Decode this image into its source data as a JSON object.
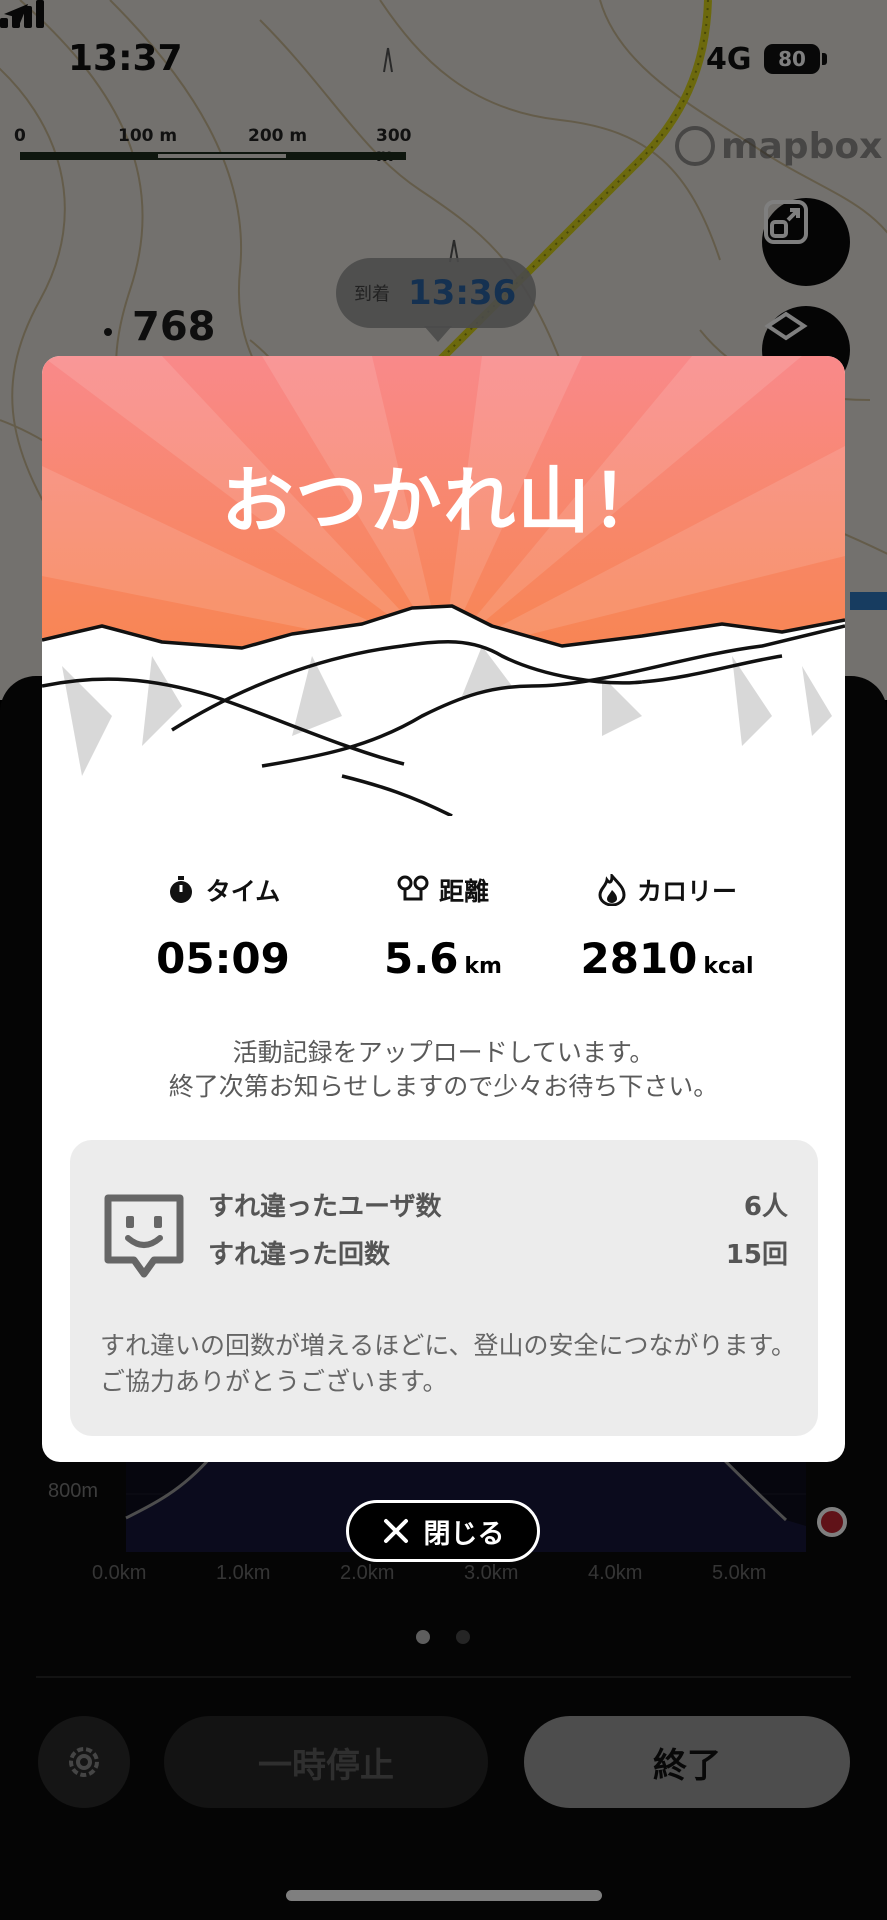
{
  "status_bar": {
    "time": "13:37",
    "network": "4G",
    "battery": "80"
  },
  "map": {
    "scale": {
      "ticks": [
        "0",
        "100 m",
        "200 m",
        "300 m"
      ]
    },
    "attribution": "mapbox",
    "arrival": {
      "label": "到着",
      "time": "13:36"
    },
    "elevation_label": "768"
  },
  "modal": {
    "title": "おつかれ山！",
    "stats": [
      {
        "label": "タイム",
        "value": "05:09",
        "unit": "",
        "icon": "stopwatch-icon"
      },
      {
        "label": "距離",
        "value": "5.6",
        "unit": "km",
        "icon": "route-icon"
      },
      {
        "label": "カロリー",
        "value": "2810",
        "unit": "kcal",
        "icon": "flame-icon"
      }
    ],
    "upload_message": {
      "line1": "活動記録をアップロードしています。",
      "line2": "終了次第お知らせしますので少々お待ち下さい。"
    },
    "passing": {
      "users_label": "すれ違ったユーザ数",
      "users_value": "6人",
      "count_label": "すれ違った回数",
      "count_value": "15回",
      "note": "すれ違いの回数が増えるほどに、登山の安全につながります。ご協力ありがとうございます。"
    }
  },
  "close_button": {
    "label": "閉じる"
  },
  "profile_chart": {
    "y_label": "800m",
    "x_ticks": [
      "0.0km",
      "1.0km",
      "2.0km",
      "3.0km",
      "4.0km",
      "5.0km"
    ]
  },
  "controls": {
    "pause_label": "一時停止",
    "end_label": "終了"
  },
  "colors": {
    "accent_orange": "#f7803a",
    "accent_pink": "#f9898a",
    "arrival_blue": "#2a63a2",
    "marker_red": "#e0303a"
  }
}
